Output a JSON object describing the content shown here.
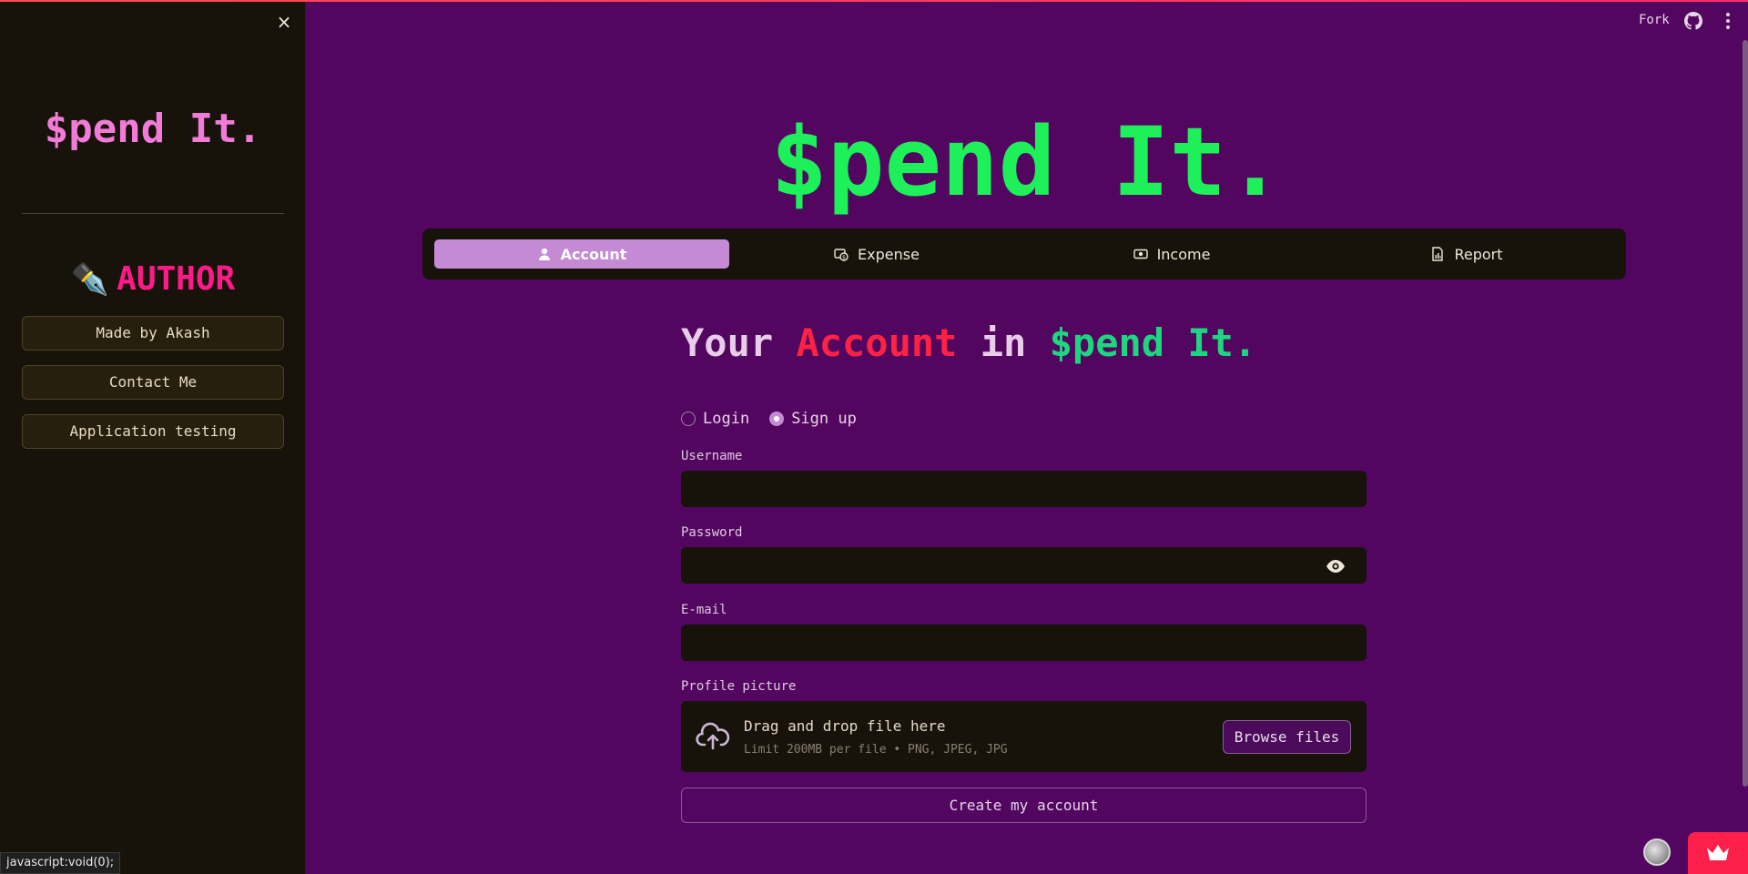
{
  "sidebar": {
    "close_label": "×",
    "brand": "$pend It.",
    "author_heading": "AUTHOR",
    "author_icon": "✒️",
    "buttons": [
      {
        "label": "Made by Akash"
      },
      {
        "label": "Contact Me"
      },
      {
        "label": "Application testing"
      }
    ]
  },
  "status_bar": {
    "link": "javascript:void(0);"
  },
  "toolbar": {
    "fork_label": "Fork",
    "github_icon": "github-icon",
    "menu_icon": "kebab-menu-icon"
  },
  "main": {
    "title": "$pend It.",
    "tabs": [
      {
        "label": "Account",
        "icon": "person-icon",
        "active": true
      },
      {
        "label": "Expense",
        "icon": "expense-icon",
        "active": false
      },
      {
        "label": "Income",
        "icon": "cash-icon",
        "active": false
      },
      {
        "label": "Report",
        "icon": "report-icon",
        "active": false
      }
    ],
    "heading": {
      "w1": "Your",
      "w2": "Account",
      "w3": "in",
      "w4": "$pend It."
    },
    "auth_mode": {
      "options": [
        "Login",
        "Sign up"
      ],
      "selected": "Sign up"
    },
    "form": {
      "username_label": "Username",
      "username_value": "",
      "password_label": "Password",
      "password_value": "",
      "email_label": "E-mail",
      "email_value": "",
      "profile_label": "Profile picture",
      "upload_title": "Drag and drop file here",
      "upload_hint": "Limit 200MB per file • PNG, JPEG, JPG",
      "browse_label": "Browse files",
      "submit_label": "Create my account"
    }
  },
  "colors": {
    "background": "#52065f",
    "sidebar": "#17130a",
    "title_green": "#1ef05a",
    "accent_pink": "#f27ad8",
    "author_pink": "#ff1a8a",
    "account_red": "#ff2244",
    "brand_teal": "#1ed680",
    "active_tab": "#c58ad4",
    "badge_red": "#ff1f4b"
  }
}
